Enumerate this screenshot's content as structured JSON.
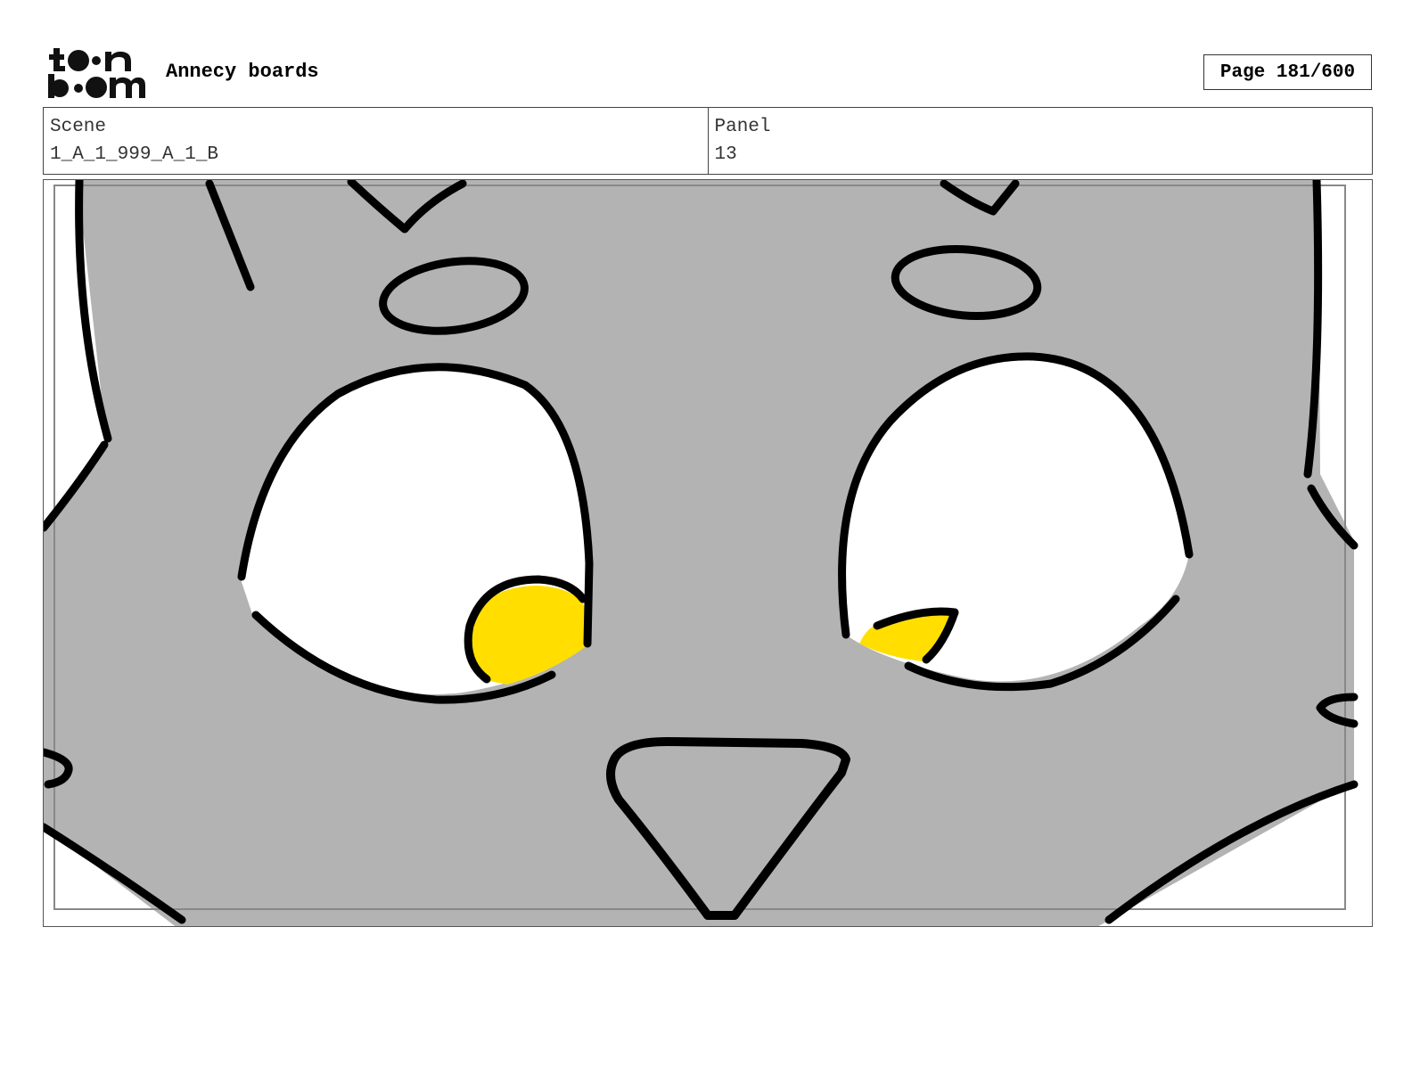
{
  "header": {
    "logo_text_top": "toon",
    "logo_text_bottom": "boom",
    "project_title": "Annecy boards",
    "page_indicator": "Page 181/600"
  },
  "info": {
    "scene_label": "Scene",
    "scene_value": "1_A_1_999_A_1_B",
    "panel_label": "Panel",
    "panel_value": "13"
  },
  "drawing": {
    "fur_color": "#b3b3b3",
    "eye_white_color": "#ffffff",
    "pupil_color": "#ffde00",
    "line_color": "#000000"
  }
}
